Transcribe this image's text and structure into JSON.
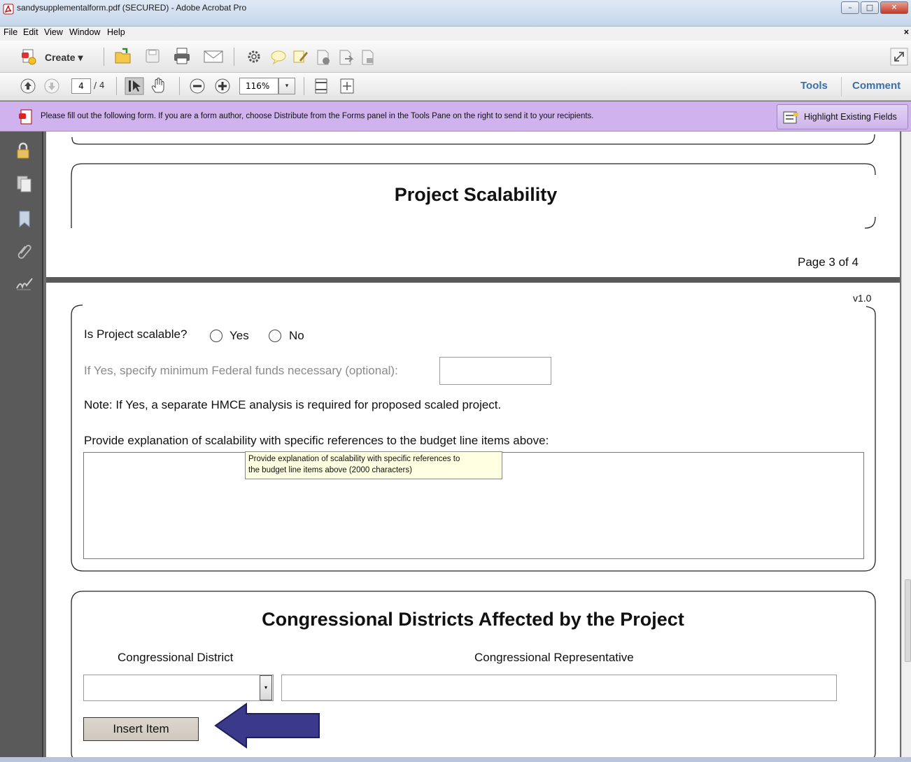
{
  "window": {
    "title": "sandysupplementalform.pdf (SECURED) - Adobe Acrobat Pro",
    "minimize": "–",
    "maximize": "□",
    "close": "✕"
  },
  "menu": {
    "items": [
      "File",
      "Edit",
      "View",
      "Window",
      "Help"
    ],
    "close_glyph": "×"
  },
  "toolbar": {
    "create_label": "Create ▾",
    "current_page": "4",
    "page_total": "/ 4",
    "zoom": "116%",
    "zoom_dropdown": "▾",
    "tools_label": "Tools",
    "comment_label": "Comment"
  },
  "formbar": {
    "message": "Please fill out the following form. If you are a form author, choose Distribute from the Forms panel in the Tools Pane on the right to send it to your recipients.",
    "highlight_label": "Highlight Existing Fields"
  },
  "document": {
    "section_scalability_title": "Project Scalability",
    "page_indicator": "Page 3 of 4",
    "version": "v1.0",
    "scalable_question": "Is Project scalable?",
    "yes_label": "Yes",
    "no_label": "No",
    "min_funds_label": "If Yes, specify minimum Federal funds necessary (optional):",
    "note": "Note: If Yes, a separate HMCE analysis is required for proposed scaled project.",
    "explanation_label": "Provide explanation of scalability with specific references to the budget line items above:",
    "tooltip_line1": "Provide explanation of scalability with specific references to",
    "tooltip_line2": "the budget line items above (2000 characters)",
    "districts_title": "Congressional Districts Affected by the Project",
    "district_col": "Congressional District",
    "representative_col": "Congressional Representative",
    "insert_button": "Insert Item",
    "dropdown_glyph": "▾"
  },
  "colors": {
    "formbar_bg": "#cfb2ee",
    "link": "#3a6fa8",
    "arrow": "#3b3a8a"
  },
  "icons": [
    "acrobat-icon",
    "create-icon",
    "open-icon",
    "save-icon",
    "print-icon",
    "email-icon",
    "settings-icon",
    "comment-icon",
    "sign-icon",
    "redact-icon",
    "export-icon",
    "security-icon",
    "prev-page-icon",
    "next-page-icon",
    "select-tool-icon",
    "hand-tool-icon",
    "zoom-out-icon",
    "zoom-in-icon",
    "fit-page-icon",
    "full-screen-icon",
    "expand-icon",
    "lock-icon",
    "pages-icon",
    "bookmark-icon",
    "attachment-icon",
    "signature-icon",
    "highlight-fields-icon",
    "arrow-icon"
  ]
}
